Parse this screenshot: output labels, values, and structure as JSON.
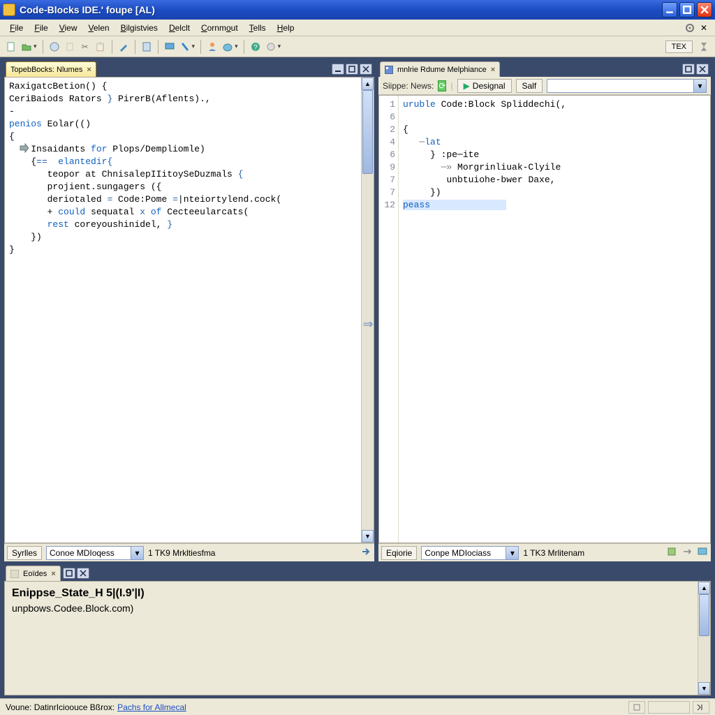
{
  "window": {
    "title": "Code-Blocks IDE.' foupe [AL)"
  },
  "menu": {
    "items": [
      "File",
      "File",
      "View",
      "Velen",
      "Bilgistvies",
      "Delclt",
      "Cornmout",
      "Tells",
      "Help"
    ]
  },
  "toolbar": {
    "right_label": "TEX"
  },
  "left_pane": {
    "tab_label": "TopebBocks: Nlumes",
    "code": {
      "l1": "RaxigatcBetion() {",
      "l2a": "CeriBaiods Rators ",
      "l2b": "}",
      "l2c": " PirerB(Aflents).,",
      "l3": "-",
      "l4a": "penios",
      "l4b": " Eolar(()",
      "l5": "{",
      "l6a": "    Insaidants ",
      "l6b": "for",
      "l6c": " Plops/Dempliomle)",
      "l7a": "    {",
      "l7b": "==",
      "l7c": "  elantedir{",
      "l8a": "       teopor at ChnisalepIIitoySeDuzmals ",
      "l8b": "{",
      "l9": "       projient.sungagers ({",
      "l10a": "       deriotaled ",
      "l10b": "=",
      "l10c": " Code:Pome ",
      "l10d": "=",
      "l10e": "|nteiortylend.cock(",
      "l11a": "       + ",
      "l11b": "could",
      "l11c": " sequatal ",
      "l11d": "x",
      "l11e": " of",
      "l11f": " Cecteeularcats(",
      "l12a": "       rest",
      "l12b": " coreyoushinidel, ",
      "l12c": "}",
      "l13": "    })",
      "l14": "}"
    },
    "bottom": {
      "tab": "Syrlles",
      "combo": "Conoe MDIoqess",
      "info": "1 TK9 Mrkltiesfma"
    }
  },
  "right_pane": {
    "tab_label": "mnlrie Rdume Melphiance",
    "subheader": {
      "label": "Siippe: News:",
      "btn_design": "Designal",
      "btn_saf": "Salf"
    },
    "gutter": [
      "1",
      "6",
      "2",
      "4",
      "6",
      "9",
      "7",
      "7",
      "12"
    ],
    "code": {
      "l1a": "uruble",
      "l1b": " Code:Block Spliddechi(,",
      "l2": "",
      "l3": "{",
      "l4a": "   ─",
      "l4b": "lat",
      "l5a": "     } ",
      "l5b": ":pe─ite",
      "l6a": "       ─» ",
      "l6b": "Morgrinliuak-Clyile",
      "l7a": "        ",
      "l7b": "unbtuiohe-bwer Daxe,",
      "l8": "     })",
      "l9a": "peass"
    },
    "bottom": {
      "tab": "Eqiorie",
      "combo": "Conpe MDIociass",
      "info": "1 TK3 Mrlitenam"
    }
  },
  "bottom_panel": {
    "tab_label": "Eoïdes",
    "headline": "Enippse_State_H 5|(I.9'|I)",
    "subline": "unpbows.Codee.Block.com)"
  },
  "status": {
    "left": "Voune: DatinrIcioouce Bßrox: ",
    "link": "Pachs for Allmecal"
  }
}
